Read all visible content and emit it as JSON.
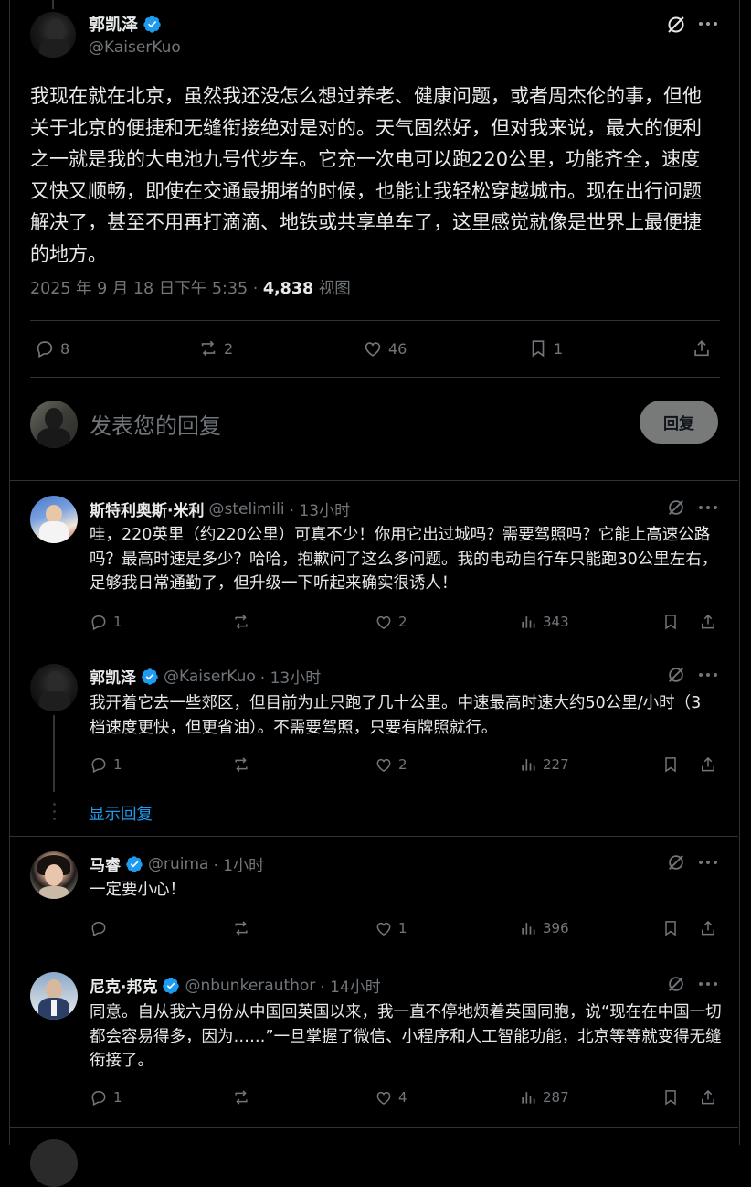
{
  "main_tweet": {
    "author_name": "郭凯泽",
    "author_handle": "@KaiserKuo",
    "text": "我现在就在北京，虽然我还没怎么想过养老、健康问题，或者周杰伦的事，但他关于北京的便捷和无缝衔接绝对是对的。天气固然好，但对我来说，最大的便利之一就是我的大电池九号代步车。它充一次电可以跑220公里，功能齐全，速度又快又顺畅，即使在交通最拥堵的时候，也能让我轻松穿越城市。现在出行问题解决了，甚至不用再打滴滴、地铁或共享单车了，这里感觉就像是世界上最便捷的地方。",
    "timestamp": "2025 年 9 月 18 日下午 5:35",
    "views_count": "4,838",
    "views_label": "视图",
    "replies": "8",
    "reposts": "2",
    "likes": "46",
    "bookmarks": "1"
  },
  "composer": {
    "placeholder": "发表您的回复",
    "button": "回复"
  },
  "replies": [
    {
      "name": "斯特利奥斯·米利",
      "handle": "@stelimili",
      "time": "· 13小时",
      "verified": false,
      "text": "哇，220英里（约220公里）可真不少！你用它出过城吗？需要驾照吗？它能上高速公路吗？最高时速是多少？哈哈，抱歉问了这么多问题。我的电动自行车只能跑30公里左右，足够我日常通勤了，但升级一下听起来确实很诱人！",
      "replies": "1",
      "reposts": "",
      "likes": "2",
      "views": "343"
    },
    {
      "name": "郭凯泽",
      "handle": "@KaiserKuo",
      "time": "· 13小时",
      "verified": true,
      "text": "我开着它去一些郊区，但目前为止只跑了几十公里。中速最高时速大约50公里/小时（3档速度更快，但更省油）。不需要驾照，只要有牌照就行。",
      "replies": "1",
      "reposts": "",
      "likes": "2",
      "views": "227"
    },
    {
      "name": "马睿",
      "handle": "@ruima",
      "time": "· 1小时",
      "verified": true,
      "text": "一定要小心！",
      "replies": "",
      "reposts": "",
      "likes": "1",
      "views": "396"
    },
    {
      "name": "尼克·邦克",
      "handle": "@nbunkerauthor",
      "time": "· 14小时",
      "verified": true,
      "text": "同意。自从我六月份从中国回英国以来，我一直不停地烦着英国同胞，说“现在在中国一切都会容易得多，因为……”一旦掌握了微信、小程序和人工智能功能，北京等等就变得无缝衔接了。",
      "replies": "1",
      "reposts": "",
      "likes": "4",
      "views": "287"
    }
  ],
  "show_replies": "显示回复",
  "colors": {
    "background": "#000000",
    "text": "#e7e9ea",
    "muted": "#71767b",
    "link": "#1d9bf0",
    "verified": "#1d9bf0",
    "divider": "#2f3336"
  },
  "icons": [
    "verified-badge-icon",
    "grok-icon",
    "more-icon",
    "reply-icon",
    "repost-icon",
    "like-icon",
    "views-icon",
    "bookmark-icon",
    "share-icon"
  ]
}
